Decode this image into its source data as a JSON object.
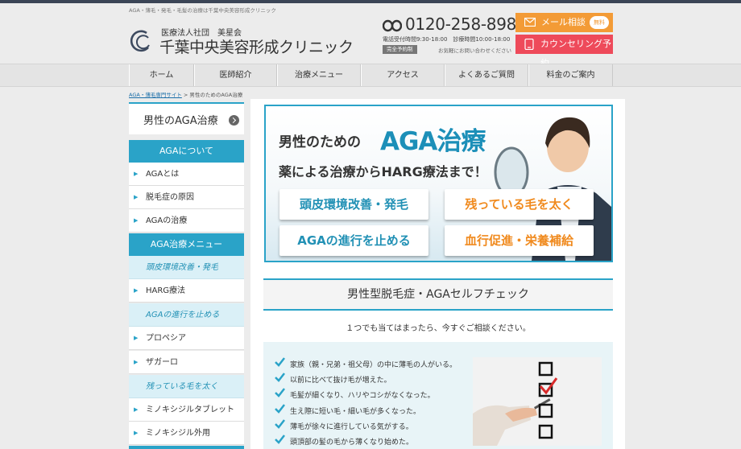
{
  "header": {
    "tagline": "AGA・薄毛・発毛・毛髪の治療は千葉中央美容形成クリニック",
    "org": "医療法人社団　美星会",
    "clinic_name": "千葉中央美容形成クリニック",
    "phone": "0120-258-898",
    "hours": "電話受付時間9:30-18:00　診療時間10:00-18:00",
    "reserve_badge": "完全予約制",
    "inquiry": "お気軽にお問い合わせください",
    "mail_button": "メール相談",
    "free_badge": "無料",
    "counsel_button": "カウンセリング予約"
  },
  "nav": [
    {
      "label": "ホーム"
    },
    {
      "label": "医師紹介"
    },
    {
      "label": "治療メニュー"
    },
    {
      "label": "アクセス"
    },
    {
      "label": "よくあるご質問"
    },
    {
      "label": "料金のご案内"
    }
  ],
  "breadcrumb": {
    "link": "AGA・薄毛専門サイト",
    "separator": " > ",
    "current": "男性のためのAGA治療"
  },
  "sidebar": {
    "heading": "男性のAGA治療",
    "about_category": "AGAについて",
    "about_items": [
      {
        "label": "AGAとは"
      },
      {
        "label": "脱毛症の原因"
      },
      {
        "label": "AGAの治療"
      }
    ],
    "menu_category": "AGA治療メニュー",
    "sub1": "頭皮環境改善・発毛",
    "sub1_items": [
      {
        "label": "HARG療法"
      }
    ],
    "sub2": "AGAの進行を止める",
    "sub2_items": [
      {
        "label": "プロペシア"
      },
      {
        "label": "ザガーロ"
      }
    ],
    "sub3": "残っている毛を太く",
    "sub3_items": [
      {
        "label": "ミノキシジルタブレット"
      },
      {
        "label": "ミノキシジル外用"
      }
    ]
  },
  "hero": {
    "line1": "男性のための",
    "line2": "AGA治療",
    "line3": "薬による治療からHARG療法まで！",
    "buttons": [
      {
        "label": "頭皮環境改善・発毛"
      },
      {
        "label": "残っている毛を太く"
      },
      {
        "label": "AGAの進行を止める"
      },
      {
        "label": "血行促進・栄養補給"
      }
    ]
  },
  "check": {
    "heading": "男性型脱毛症・AGAセルフチェック",
    "lead": "１つでも当てはまったら、今すぐご相談ください。",
    "items": [
      {
        "label": "家族（親・兄弟・祖父母）の中に薄毛の人がいる。"
      },
      {
        "label": "以前に比べて抜け毛が増えた。"
      },
      {
        "label": "毛髪が細くなり、ハリやコシがなくなった。"
      },
      {
        "label": "生え際に短い毛・細い毛が多くなった。"
      },
      {
        "label": "薄毛が徐々に進行している気がする。"
      },
      {
        "label": "頭頂部の髪の毛から薄くなり始めた。"
      }
    ]
  },
  "colors": {
    "accent": "#2aa3c8",
    "mail": "#f39b36",
    "counsel": "#ee4a5a",
    "hero_blue": "#1c8fb8",
    "hero_orange": "#f08a1e"
  }
}
